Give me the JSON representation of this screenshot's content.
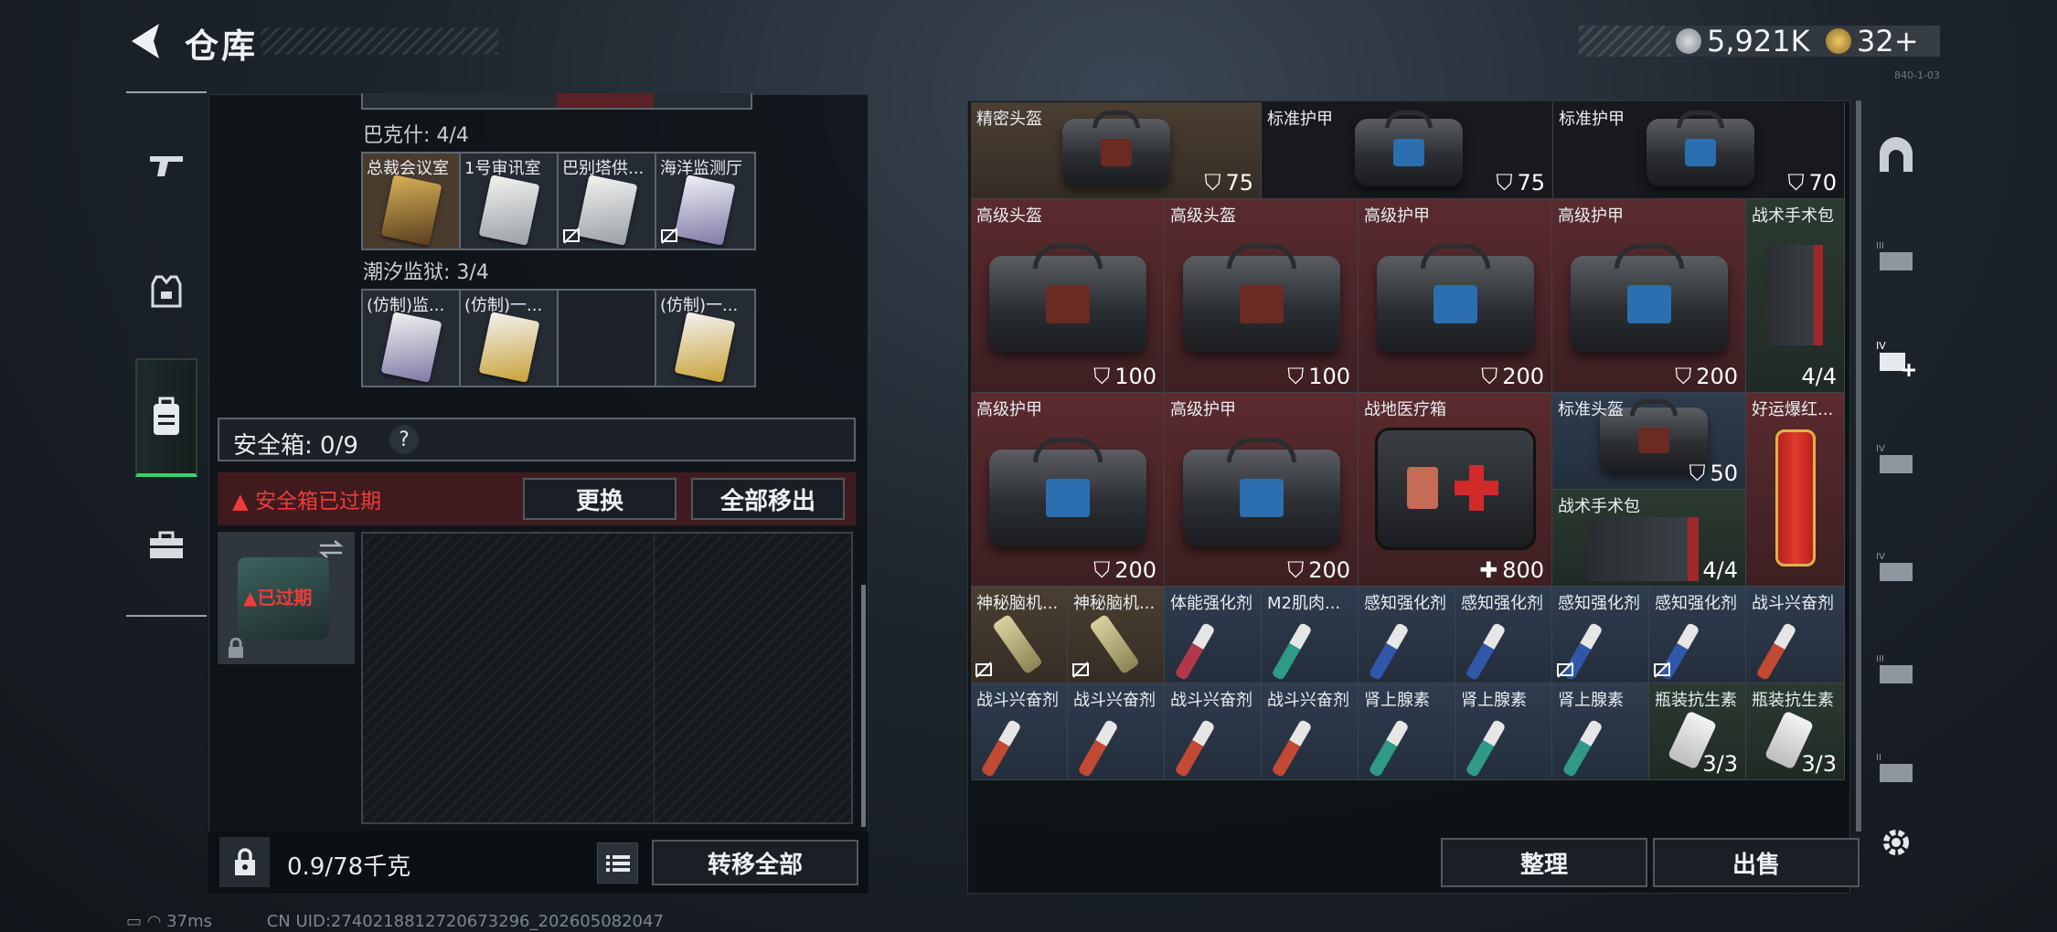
{
  "header": {
    "title": "仓库",
    "currency1": "5,921K",
    "currency2": "32+",
    "version": "840-1-03"
  },
  "left": {
    "group1_partial_label": "",
    "group2": {
      "label": "巴克什: 4/4",
      "cards": [
        "总裁会议室",
        "1号审讯室",
        "巴别塔供...",
        "海洋监测厅"
      ]
    },
    "group3": {
      "label": "潮汐监狱: 3/4",
      "cards": [
        "(仿制)监...",
        "(仿制)一...",
        "",
        "(仿制)一..."
      ]
    },
    "safebox": {
      "title": "安全箱: 0/9",
      "help": "?",
      "expired": "安全箱已过期",
      "replace": "更换",
      "remove_all": "全部移出",
      "slot_label": "已过期"
    },
    "weight": "0.9/78千克",
    "transfer_all": "转移全部"
  },
  "right": {
    "row1": [
      {
        "name": "精密头盔",
        "val": "75"
      },
      {
        "name": "标准护甲",
        "val": "75"
      },
      {
        "name": "标准护甲",
        "val": "70"
      }
    ],
    "row2": [
      {
        "name": "高级头盔",
        "val": "100"
      },
      {
        "name": "高级头盔",
        "val": "100"
      },
      {
        "name": "高级护甲",
        "val": "200"
      },
      {
        "name": "高级护甲",
        "val": "200"
      },
      {
        "name": "战术手术包",
        "val": "4/4"
      }
    ],
    "row3": [
      {
        "name": "高级护甲",
        "val": "200"
      },
      {
        "name": "高级护甲",
        "val": "200"
      },
      {
        "name": "战地医疗箱",
        "val": "800"
      },
      {
        "name": "标准头盔",
        "val": "50"
      },
      {
        "name": "好运爆红...",
        "val": ""
      },
      {
        "name": "战术手术包",
        "val": "4/4"
      }
    ],
    "row4": [
      "神秘脑机...",
      "神秘脑机...",
      "体能强化剂",
      "M2肌肉...",
      "感知强化剂",
      "感知强化剂",
      "感知强化剂",
      "感知强化剂",
      "战斗兴奋剂"
    ],
    "row5": [
      {
        "name": "战斗兴奋剂",
        "val": ""
      },
      {
        "name": "战斗兴奋剂",
        "val": ""
      },
      {
        "name": "战斗兴奋剂",
        "val": ""
      },
      {
        "name": "战斗兴奋剂",
        "val": ""
      },
      {
        "name": "肾上腺素",
        "val": ""
      },
      {
        "name": "肾上腺素",
        "val": ""
      },
      {
        "name": "肾上腺素",
        "val": ""
      },
      {
        "name": "瓶装抗生素",
        "val": "3/3"
      },
      {
        "name": "瓶装抗生素",
        "val": "3/3"
      }
    ],
    "sort": "整理",
    "sell": "出售"
  },
  "status": {
    "ping": "37ms",
    "uid": "CN UID:2740218812720673296_202605082047"
  },
  "colors": {
    "accent_green": "#39d26a",
    "danger": "#ef3b3b"
  }
}
